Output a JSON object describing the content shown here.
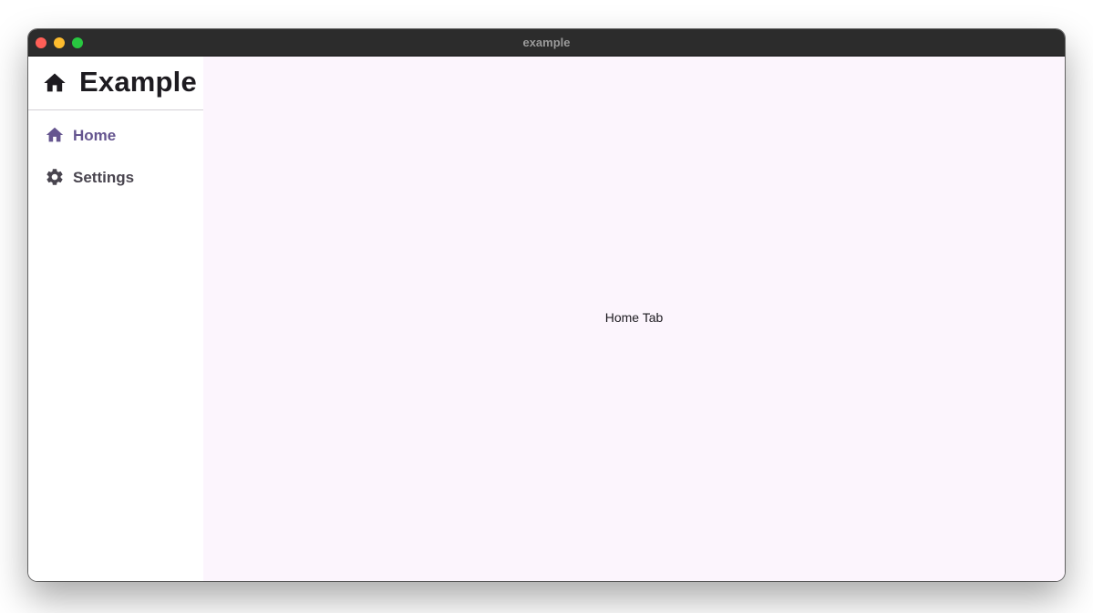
{
  "window": {
    "title": "example",
    "controls": {
      "close_color": "#ff5f57",
      "minimize_color": "#febc2e",
      "maximize_color": "#28c840"
    }
  },
  "sidebar": {
    "header": {
      "icon": "home-icon",
      "title": "Example"
    },
    "items": [
      {
        "label": "Home",
        "icon": "home-icon",
        "selected": true,
        "color": "#65558f"
      },
      {
        "label": "Settings",
        "icon": "gear-icon",
        "selected": false,
        "color": "#49454f"
      }
    ]
  },
  "main": {
    "content_text": "Home Tab",
    "background": "#fcf5fd"
  }
}
